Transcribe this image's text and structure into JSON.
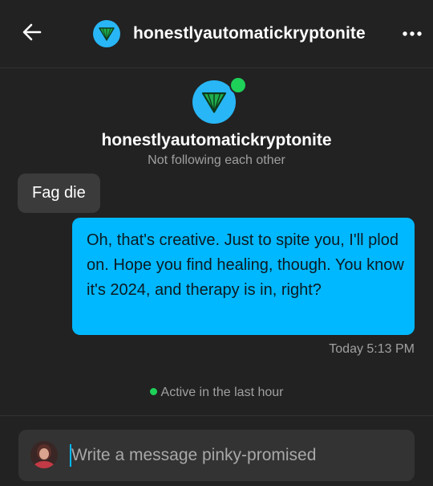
{
  "header": {
    "back_icon": "arrow-left-icon",
    "avatar_icon": "green-cone-avatar",
    "title": "honestlyautomatickryptonite",
    "more_icon": "more-dots-icon"
  },
  "profile": {
    "name": "honestlyautomatickryptonite",
    "relation": "Not following each other",
    "online": true
  },
  "messages": [
    {
      "direction": "incoming",
      "text": "Fag die"
    },
    {
      "direction": "outgoing",
      "text": "Oh, that's creative. Just to spite you, I'll plod on. Hope you find healing, though. You know it's 2024, and therapy is in, right?",
      "time": "Today 5:13 PM"
    }
  ],
  "status": {
    "text": "Active in the last hour"
  },
  "composer": {
    "placeholder": "Write a message pinky-promised"
  },
  "colors": {
    "background": "#222222",
    "outgoing_bubble": "#00b8ff",
    "incoming_bubble": "#3b3b3b",
    "avatar_blue": "#28b6f6",
    "online_green": "#1ed158",
    "muted_text": "#a0a0a0"
  }
}
